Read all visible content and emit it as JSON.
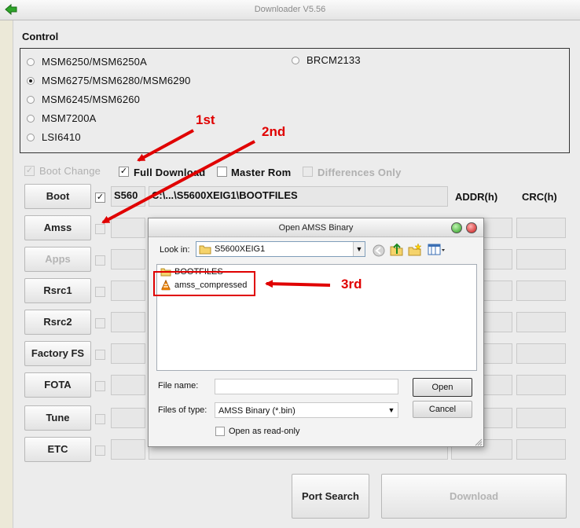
{
  "window": {
    "title": "Downloader V5.56"
  },
  "control": {
    "label": "Control",
    "options_left": [
      {
        "label": "MSM6250/MSM6250A",
        "selected": false
      },
      {
        "label": "MSM6275/MSM6280/MSM6290",
        "selected": true
      },
      {
        "label": "MSM6245/MSM6260",
        "selected": false
      },
      {
        "label": "MSM7200A",
        "selected": false
      },
      {
        "label": "LSI6410",
        "selected": false
      }
    ],
    "options_right": [
      {
        "label": "BRCM2133",
        "selected": false
      }
    ]
  },
  "flags": {
    "boot_change": {
      "label": "Boot Change",
      "checked": true,
      "enabled": false
    },
    "full_download": {
      "label": "Full Download",
      "checked": true,
      "enabled": true
    },
    "master_rom": {
      "label": "Master Rom",
      "checked": false,
      "enabled": true
    },
    "differences_only": {
      "label": "Differences Only",
      "checked": false,
      "enabled": false
    }
  },
  "columns": {
    "addr": "ADDR(h)",
    "crc": "CRC(h)"
  },
  "rows": [
    {
      "button": "Boot",
      "checked": true,
      "short": "S560",
      "path": "C:\\...\\S5600XEIG1\\BOOTFILES",
      "enabled": true
    },
    {
      "button": "Amss",
      "checked": false,
      "short": "",
      "path": "",
      "enabled": true
    },
    {
      "button": "Apps",
      "checked": false,
      "short": "",
      "path": "",
      "enabled": false
    },
    {
      "button": "Rsrc1",
      "checked": false,
      "short": "",
      "path": "",
      "enabled": true
    },
    {
      "button": "Rsrc2",
      "checked": false,
      "short": "",
      "path": "",
      "enabled": true
    },
    {
      "button": "Factory FS",
      "checked": false,
      "short": "",
      "path": "",
      "enabled": true
    },
    {
      "button": "FOTA",
      "checked": false,
      "short": "",
      "path": "",
      "enabled": true
    },
    {
      "button": "Tune",
      "checked": false,
      "short": "",
      "path": "",
      "enabled": true
    },
    {
      "button": "ETC",
      "checked": false,
      "short": "",
      "path": "",
      "enabled": true
    }
  ],
  "bottom": {
    "port_search": "Port Search",
    "download": "Download"
  },
  "dialog": {
    "title": "Open AMSS Binary",
    "look_in_label": "Look in:",
    "look_in_value": "S5600XEIG1",
    "files": [
      {
        "name": "BOOTFILES",
        "icon": "folder-icon"
      },
      {
        "name": "amss_compressed",
        "icon": "vlc-cone-icon"
      }
    ],
    "file_name_label": "File name:",
    "file_name_value": "",
    "files_of_type_label": "Files of type:",
    "files_of_type_value": "AMSS Binary (*.bin)",
    "read_only_label": "Open as read-only",
    "open_label": "Open",
    "cancel_label": "Cancel"
  },
  "annotations": {
    "first": "1st",
    "second": "2nd",
    "third": "3rd"
  },
  "colors": {
    "annotation": "#e00000",
    "window_bg": "#ececec"
  }
}
